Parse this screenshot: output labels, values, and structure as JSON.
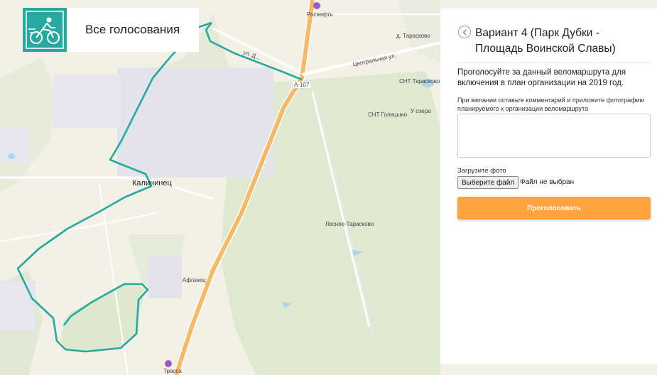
{
  "header": {
    "title": "Все голосования"
  },
  "panel": {
    "route_title": "Вариант 4 (Парк Дубки - Площадь Воинской Славы)",
    "vote_description": "Проголосуйте за данный веломаршрута для включения в план организации на 2019 год.",
    "comment_label": "При желании оставьте комментарий и приложите фотографию планируемого к организации веломаршрута",
    "comment_value": "",
    "upload_label": "Загрузите фото",
    "choose_file_label": "Выберите файл",
    "file_status": "Файл не выбран",
    "vote_button_label": "Проголосовать"
  },
  "map": {
    "labels": {
      "rosneft": "Роснефть",
      "tarasovo_village": "д. Тарасково",
      "central_street": "Центральная ул.",
      "highway_code": "А-107",
      "snt_tarasovo": "СНТ Тарасково",
      "snt_golitsyno": "СНТ Голицыно",
      "u_ozera": "У озера",
      "kalininets": "Калининец",
      "lesnoe_tarasovo": "Лесное-Тарасково",
      "afganets": "Афганец",
      "trassa": "Трасса",
      "street_small": "ул. Д..."
    },
    "route_color": "#26a9a0"
  }
}
